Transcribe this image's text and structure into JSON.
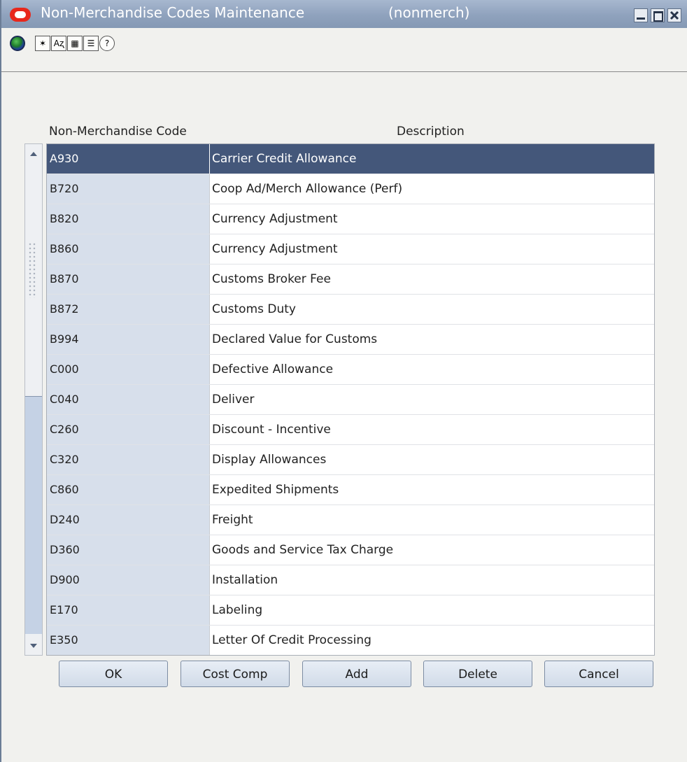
{
  "window": {
    "title": "Non-Merchandise Codes Maintenance",
    "subtitle": "(nonmerch)",
    "accent_color": "#44577a",
    "title_bar_color": "#8fa2bd"
  },
  "toolbar": {
    "icons": [
      "globe-icon",
      "history-icon",
      "find-replace-icon",
      "calendar-icon",
      "print-icon",
      "help-icon"
    ],
    "icon_glyphs": {
      "history": "✶",
      "find": "Aʐ",
      "calendar": "▦",
      "print": "☰",
      "help": "?"
    }
  },
  "table": {
    "columns": [
      "Non-Merchandise Code",
      "Description"
    ],
    "rows": [
      {
        "code": "A930",
        "description": "Carrier Credit Allowance",
        "selected": true
      },
      {
        "code": "B720",
        "description": "Coop Ad/Merch Allowance (Perf)"
      },
      {
        "code": "B820",
        "description": "Currency Adjustment"
      },
      {
        "code": "B860",
        "description": "Currency Adjustment"
      },
      {
        "code": "B870",
        "description": "Customs Broker Fee"
      },
      {
        "code": "B872",
        "description": "Customs Duty"
      },
      {
        "code": "B994",
        "description": "Declared Value for Customs"
      },
      {
        "code": "C000",
        "description": "Defective Allowance"
      },
      {
        "code": "C040",
        "description": "Deliver"
      },
      {
        "code": "C260",
        "description": "Discount - Incentive"
      },
      {
        "code": "C320",
        "description": "Display Allowances"
      },
      {
        "code": "C860",
        "description": "Expedited Shipments"
      },
      {
        "code": "D240",
        "description": "Freight"
      },
      {
        "code": "D360",
        "description": "Goods and Service Tax Charge"
      },
      {
        "code": "D900",
        "description": "Installation"
      },
      {
        "code": "E170",
        "description": "Labeling"
      },
      {
        "code": "E350",
        "description": "Letter Of Credit Processing"
      }
    ]
  },
  "buttons": {
    "ok": "OK",
    "cost_comp": "Cost Comp",
    "add": "Add",
    "delete": "Delete",
    "cancel": "Cancel"
  }
}
